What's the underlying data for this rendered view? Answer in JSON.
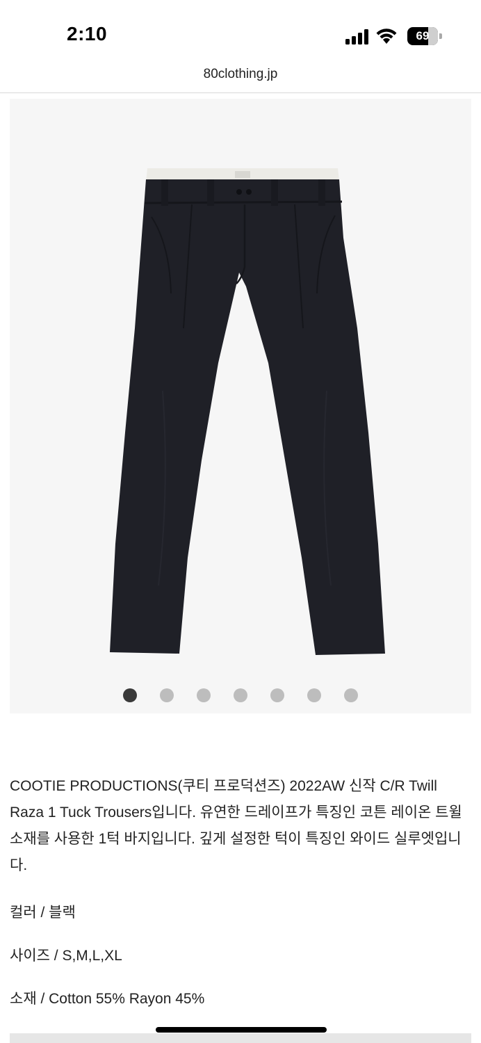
{
  "status_bar": {
    "time": "2:10",
    "battery": "69",
    "battery_level_percent": 69
  },
  "browser": {
    "url": "80clothing.jp"
  },
  "gallery": {
    "slide_count": 7,
    "active_index": 0,
    "product_color_hex": "#1f2027"
  },
  "product": {
    "description": "COOTIE PRODUCTIONS(쿠티 프로덕션즈) 2022AW 신작 C/R Twill Raza 1 Tuck Trousers입니다. 유연한 드레이프가 특징인 코튼 레이온 트윌 소재를 사용한 1턱 바지입니다. 깊게 설정한 턱이 특징인 와이드 실루엣입니다.",
    "color_line": "컬러 / 블랙",
    "size_line": "사이즈 / S,M,L,XL",
    "material_line": "소재 / Cotton 55% Rayon 45%"
  }
}
